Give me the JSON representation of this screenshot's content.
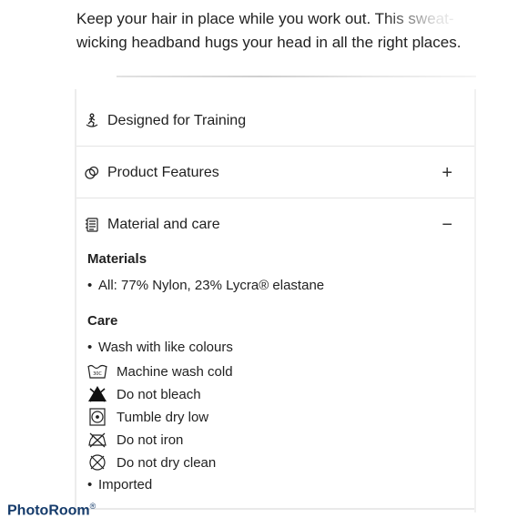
{
  "intro": {
    "text": "Keep your hair in place while you work out. This sweat-wicking headband hugs your head in all the right places."
  },
  "accordion": [
    {
      "label": "Designed for Training",
      "icon": "runner-icon",
      "toggle": ""
    },
    {
      "label": "Product Features",
      "icon": "features-icon",
      "toggle": "+"
    },
    {
      "label": "Material and care",
      "icon": "care-label-icon",
      "toggle": "−"
    }
  ],
  "materials": {
    "heading": "Materials",
    "items": [
      "All: 77% Nylon, 23% Lycra® elastane"
    ]
  },
  "care": {
    "heading": "Care",
    "items": [
      {
        "text": "Wash with like colours",
        "icon": "bullet"
      },
      {
        "text": "Machine wash cold",
        "icon": "wash-30-icon"
      },
      {
        "text": "Do not bleach",
        "icon": "no-bleach-icon"
      },
      {
        "text": "Tumble dry low",
        "icon": "tumble-dry-low-icon"
      },
      {
        "text": "Do not iron",
        "icon": "no-iron-icon"
      },
      {
        "text": "Do not dry clean",
        "icon": "no-dry-clean-icon"
      },
      {
        "text": "Imported",
        "icon": "bullet"
      }
    ]
  },
  "wash_temp_label": "30C",
  "watermark": {
    "text": "PhotoRoom",
    "mark": "®"
  }
}
